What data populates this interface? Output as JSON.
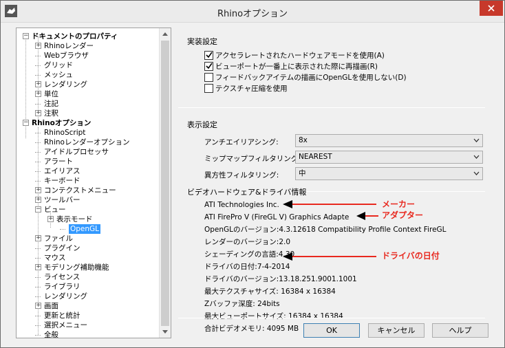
{
  "window": {
    "title": "Rhinoオプション",
    "icon": "rhino-icon",
    "close_icon": "close-icon"
  },
  "tree": {
    "items": [
      {
        "label": "ドキュメントのプロパティ",
        "expander": "−"
      },
      {
        "label": "Rhinoレンダー",
        "expander": "+"
      },
      {
        "label": "Webブラウザ"
      },
      {
        "label": "グリッド"
      },
      {
        "label": "メッシュ"
      },
      {
        "label": "レンダリング",
        "expander": "+"
      },
      {
        "label": "単位",
        "expander": "+"
      },
      {
        "label": "注記"
      },
      {
        "label": "注釈",
        "expander": "+"
      },
      {
        "label": "Rhinoオプション",
        "expander": "−"
      },
      {
        "label": "RhinoScript"
      },
      {
        "label": "Rhinoレンダーオプション"
      },
      {
        "label": "アイドルプロセッサ"
      },
      {
        "label": "アラート"
      },
      {
        "label": "エイリアス"
      },
      {
        "label": "キーボード"
      },
      {
        "label": "コンテクストメニュー",
        "expander": "+"
      },
      {
        "label": "ツールバー",
        "expander": "+"
      },
      {
        "label": "ビュー",
        "expander": "−"
      },
      {
        "label": "表示モード",
        "expander": "+"
      },
      {
        "label": "OpenGL",
        "selected": true
      },
      {
        "label": "ファイル",
        "expander": "+"
      },
      {
        "label": "プラグイン"
      },
      {
        "label": "マウス"
      },
      {
        "label": "モデリング補助機能",
        "expander": "+"
      },
      {
        "label": "ライセンス"
      },
      {
        "label": "ライブラリ"
      },
      {
        "label": "レンダリング"
      },
      {
        "label": "画面",
        "expander": "+"
      },
      {
        "label": "更新と統計"
      },
      {
        "label": "選択メニュー"
      },
      {
        "label": "全般"
      }
    ]
  },
  "hardware": {
    "section_title": "実装設定",
    "checkboxes": [
      {
        "label": "アクセラレートされたハードウェアモードを使用(A)",
        "checked": true
      },
      {
        "label": "ビューポートが一番上に表示された際に再描画(R)",
        "checked": true
      },
      {
        "label": "フィードバックアイテムの描画にOpenGLを使用しない(D)",
        "checked": false
      },
      {
        "label": "テクスチャ圧縮を使用",
        "checked": false
      }
    ]
  },
  "display": {
    "section_title": "表示設定",
    "fields": [
      {
        "label": "アンチエイリアシング:",
        "value": "8x"
      },
      {
        "label": "ミップマップフィルタリング:",
        "value": "NEAREST"
      },
      {
        "label": "異方性フィルタリング:",
        "value": "中"
      }
    ]
  },
  "video": {
    "section_title": "ビデオハードウェア&ドライバ情報",
    "lines": [
      "ATI Technologies Inc.",
      "ATI FirePro V (FireGL V) Graphics Adapte",
      "OpenGLのバージョン:4.3.12618 Compatibility Profile Context FireGL",
      "レンダーのバージョン:2.0",
      "シェーディングの言語:4.30",
      "ドライバの日付:7-4-2014",
      "ドライバのバージョン:13.18.251.9001.1001",
      "最大テクスチャサイズ: 16384 x 16384",
      "Zバッファ深度: 24bits",
      "最大ビューポートサイズ: 16384 x 16384",
      "合計ビデオメモリ: 4095 MB"
    ]
  },
  "annotations": {
    "maker": "メーカー",
    "adapter": "アダプター",
    "driver_date": "ドライバの日付",
    "color": "#e8281e"
  },
  "buttons": {
    "ok": "OK",
    "cancel": "キャンセル",
    "help": "ヘルプ"
  }
}
